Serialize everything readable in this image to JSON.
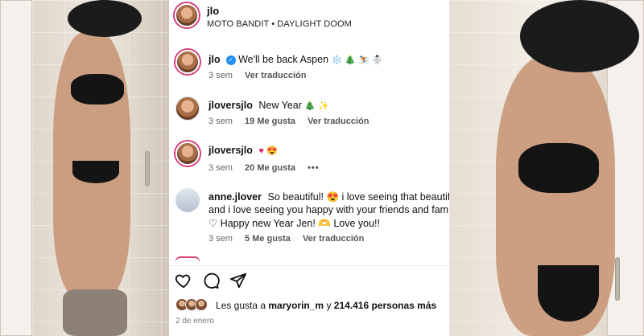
{
  "post": {
    "username": "jlo",
    "music": "MOTO BANDIT • DAYLIGHT DOOM"
  },
  "comments": [
    {
      "username": "jlo",
      "text": "We'll be back Aspen",
      "emojis": "❄️ 🎄 ⛷️ ☃️",
      "time": "3 sem",
      "likes": "",
      "translate": "Ver traducción",
      "verified": true
    },
    {
      "username": "jloversjlo",
      "text": "New Year",
      "emojis": "🎄 ✨",
      "time": "3 sem",
      "likes": "19 Me gusta",
      "translate": "Ver traducción"
    },
    {
      "username": "jloversjlo",
      "text": "",
      "emojis": "♥ 😍",
      "time": "3 sem",
      "likes": "20 Me gusta",
      "more": "•••"
    },
    {
      "username": "anne.jlover",
      "text": "So beautiful! 😍 i love seeing that beautifu",
      "line2": "and i love seeing you happy with your friends and fam",
      "line3": "♡ Happy new Year Jen! 🫶 Love you!!",
      "time": "3 sem",
      "likes": "5 Me gusta",
      "translate": "Ver traducción"
    }
  ],
  "likes": {
    "prefix": "Les gusta a",
    "user": "maryorin_m",
    "connector": "y",
    "count": "214.416 personas más"
  },
  "date": "2 de enero",
  "icons": {
    "like": "heart-outline-icon",
    "comment": "comment-bubble-icon",
    "share": "send-paper-plane-icon"
  },
  "colors": {
    "verified": "#1f8ef1",
    "story_ring": "#d63e7c",
    "heart": "#e0245e"
  }
}
